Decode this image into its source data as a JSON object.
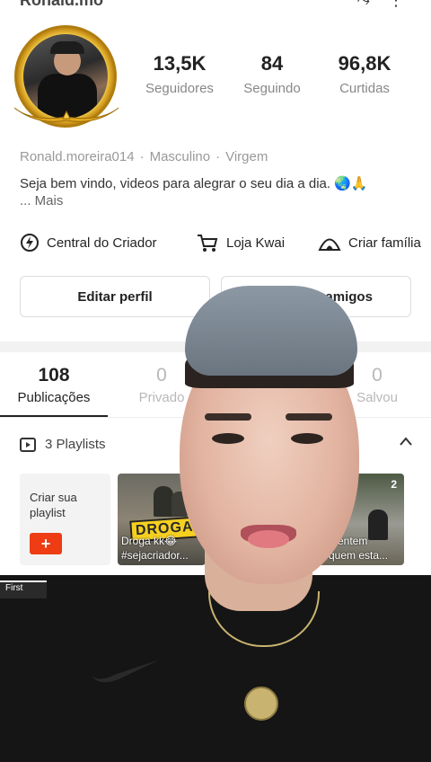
{
  "profile": {
    "header_name_cut": "Ronald.mo",
    "username": "Ronald.moreira014",
    "gender": "Masculino",
    "sign": "Virgem",
    "bio": "Seja bem vindo, videos para alegrar o seu dia a dia. 🌏🙏",
    "bio_more": "...  Mais"
  },
  "stats": [
    {
      "value": "13,5K",
      "label": "Seguidores"
    },
    {
      "value": "84",
      "label": "Seguindo"
    },
    {
      "value": "96,8K",
      "label": "Curtidas"
    }
  ],
  "links": {
    "creator_center": "Central do Criador",
    "shop": "Loja Kwai",
    "family": "Criar família"
  },
  "buttons": {
    "edit_profile": "Editar perfil",
    "add_friends": "Adicionar amigos"
  },
  "tabs": [
    {
      "count": "108",
      "label": "Publicações",
      "active": true
    },
    {
      "count": "0",
      "label": "Privado",
      "active": false
    },
    {
      "count": "",
      "label": "",
      "active": false
    },
    {
      "count": "0",
      "label": "Salvou",
      "active": false
    }
  ],
  "playlists": {
    "header": "3 Playlists",
    "create_label": "Criar sua playlist",
    "create_plus": "+",
    "items": [
      {
        "badge": "DROGA",
        "caption_line1": "Droga kk😂",
        "caption_line2": "#sejacriador..."
      },
      {
        "count": "2",
        "caption_line1": "mentem",
        "caption_line2": "quem esta..."
      }
    ]
  },
  "overlay": {
    "strip_label": "First"
  },
  "colors": {
    "accent": "#ee3c14",
    "gold": "#f7d04a"
  }
}
